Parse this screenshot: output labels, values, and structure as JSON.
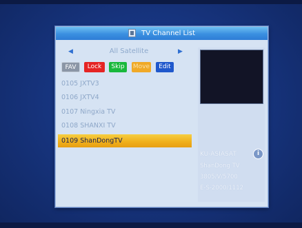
{
  "dialog": {
    "title": "TV Channel List",
    "title_icon": "tv-list-icon"
  },
  "satellite": {
    "left_arrow": "◀",
    "label": "All Satellite",
    "right_arrow": "▶"
  },
  "function_keys": {
    "fav": "FAV",
    "lock": "Lock",
    "skip": "Skip",
    "move": "Move",
    "edit": "Edit",
    "colors": {
      "fav": "#8b96a6",
      "lock": "#e52424",
      "skip": "#19b83c",
      "move": "#f0a927",
      "edit": "#1f58cc"
    }
  },
  "channels": [
    {
      "label": "0105 JXTV3"
    },
    {
      "label": "0106 JXTV4"
    },
    {
      "label": "0107 Ningxia TV"
    },
    {
      "label": "0108 SHANXI TV"
    },
    {
      "label": "0109 ShanDongTV",
      "selected": true
    }
  ],
  "info": {
    "satellite": "KU-ASIASAT",
    "channel": "ShanDong TV",
    "transponder": "3805/V/5700",
    "pids": "E-S-2000/1112"
  },
  "colors": {
    "accent_title": "#3a8fe0",
    "selection": "#f0b11c",
    "background": "#173580"
  }
}
